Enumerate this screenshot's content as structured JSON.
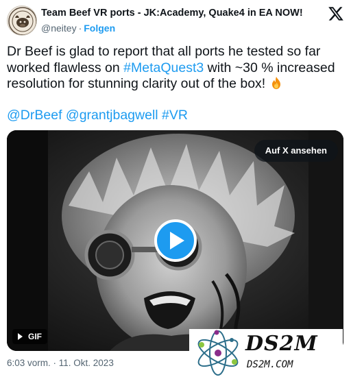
{
  "author": {
    "display_name": "Team Beef VR ports - JK:Academy, Quake4 in EA NOW!",
    "handle": "@neitey",
    "separator": "·",
    "follow_label": "Folgen"
  },
  "tweet": {
    "line1": "Dr Beef is glad to report that all ports he tested so far",
    "line2_pre": "worked flawless on ",
    "line2_link": "#MetaQuest3",
    "line2_post": " with ~30 % increased",
    "line3": "resolution for stunning clarity out of the box! ",
    "mention1": "@DrBeef",
    "mention2": "@grantjbagwell",
    "hashtag": "#VR"
  },
  "media": {
    "view_on_x_label": "Auf X ansehen",
    "gif_label": "GIF"
  },
  "timestamp": "6:03 vorm. · 11. Okt. 2023",
  "watermark": {
    "title": "DS2M",
    "url": "DS2M.COM"
  },
  "colors": {
    "link": "#1d9bf0",
    "text": "#0f1419",
    "secondary": "#536471"
  },
  "icons": {
    "x_logo": "x-logo-icon",
    "play": "play-icon",
    "fire": "fire-emoji-icon"
  }
}
